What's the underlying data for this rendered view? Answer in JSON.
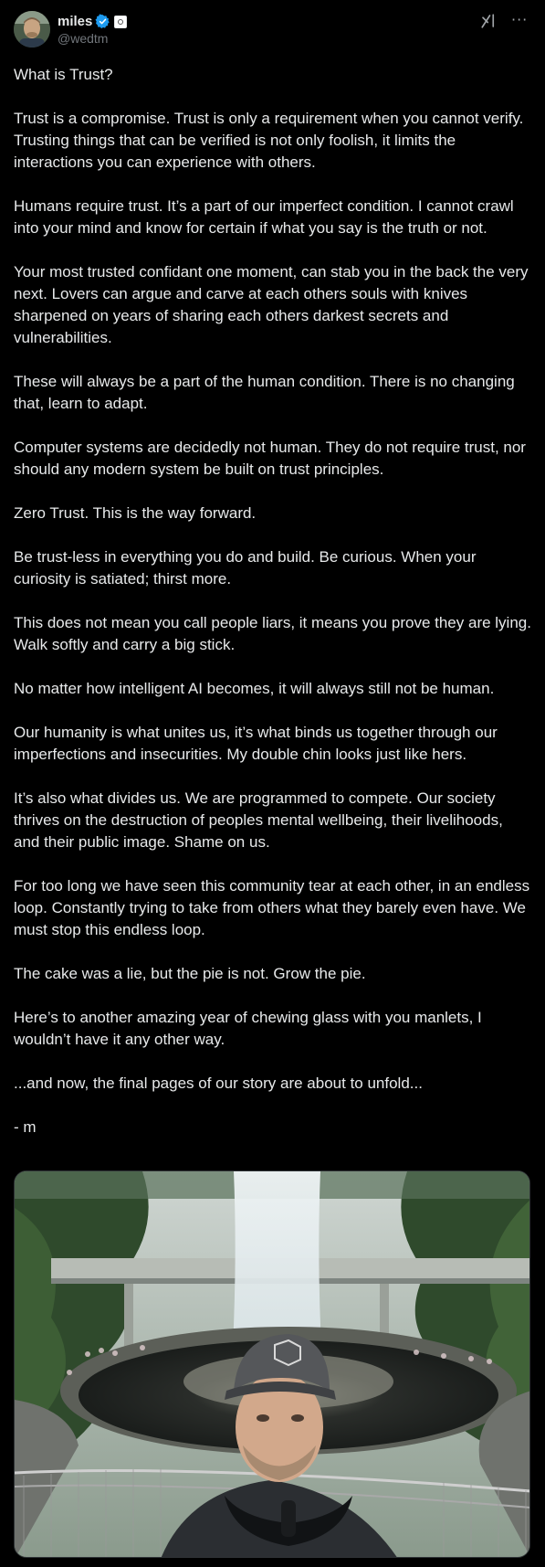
{
  "post": {
    "author": {
      "display_name": "miles",
      "handle": "@wedtm",
      "verified": true,
      "verified_color": "#1d9bf0"
    },
    "icons": {
      "avatar": "avatar-photo",
      "verified": "verified-badge-icon",
      "affiliation": "affiliation-badge-icon",
      "grok": "grok-icon",
      "more": "more-options-icon"
    },
    "more_label": "···",
    "paragraphs": [
      "What is Trust?",
      "Trust is a compromise. Trust is only a requirement when you cannot verify. Trusting things that can be verified is not only foolish, it limits the interactions you can experience with others.",
      "Humans require trust. It’s a part of our imperfect condition. I cannot crawl into your mind and know for certain if what you say is the truth or not.",
      "Your most trusted confidant one moment, can stab you in the back the very next. Lovers can argue and carve at each others souls with knives sharpened on years of sharing each others darkest secrets and vulnerabilities.",
      "These will always be a part of the human condition. There is no changing that, learn to adapt.",
      "Computer systems are decidedly not human. They do not require trust, nor should any modern system be built on trust principles.",
      "Zero Trust. This is the way forward.",
      "Be trust-less in everything you do and build. Be curious. When your curiosity is satiated; thirst more.",
      "This does not mean you call people liars, it means you prove they are lying. Walk softly and carry a big stick.",
      "No matter how intelligent AI becomes, it will always still not be human.",
      "Our humanity is what unites us, it’s what binds us together through our imperfections and insecurities. My double chin looks just like hers.",
      "It’s also what divides us. We are programmed to compete. Our society thrives on the destruction of peoples mental wellbeing, their livelihoods, and their public image. Shame on us.",
      "For too long we have seen this community tear at each other, in an endless loop. Constantly trying to take from others what they barely even have. We must stop this endless loop.",
      "The cake was a lie, but the pie is not. Grow the pie.",
      "Here’s to another amazing year of chewing glass with you manlets, I wouldn’t have it any other way.",
      "...and now, the final pages of our story are about to unfold...",
      "- m"
    ],
    "media": {
      "kind": "photo"
    }
  }
}
